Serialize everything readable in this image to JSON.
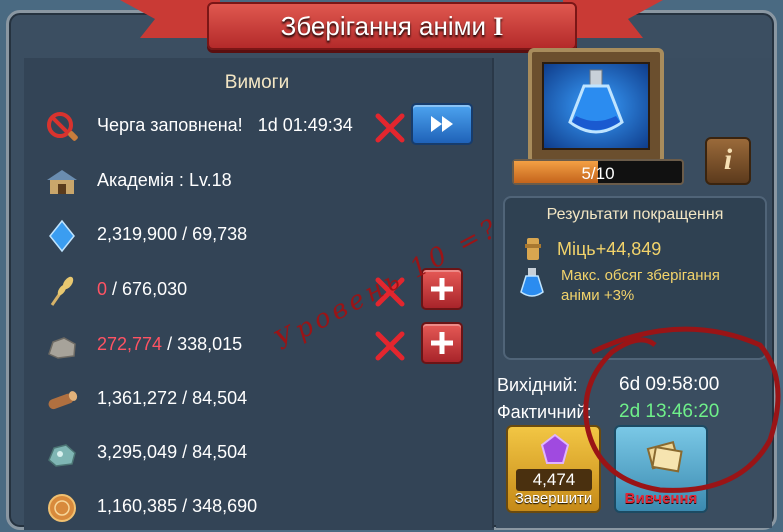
{
  "window": {
    "title": "Зберігання аніми",
    "title_roman": "I"
  },
  "requirements": {
    "header": "Вимоги",
    "rows": [
      {
        "icon": "queue-icon",
        "text": "Черга заповнена!",
        "extra": "1d 01:49:34",
        "status": "fail",
        "action": "speedup"
      },
      {
        "icon": "academy-icon",
        "label": "Академія :",
        "value": "Lv.18",
        "status": "ok"
      },
      {
        "icon": "anima-crystal-icon",
        "have": "2,319,900",
        "need": "69,738",
        "status": "ok"
      },
      {
        "icon": "grain-icon",
        "have": "0",
        "need": "676,030",
        "status": "fail",
        "action": "add"
      },
      {
        "icon": "stone-icon",
        "have": "272,774",
        "need": "338,015",
        "status": "fail",
        "action": "add"
      },
      {
        "icon": "timber-icon",
        "have": "1,361,272",
        "need": "84,504",
        "status": "ok"
      },
      {
        "icon": "ore-icon",
        "have": "3,295,049",
        "need": "84,504",
        "status": "ok"
      },
      {
        "icon": "gold-icon",
        "have": "1,160,385",
        "need": "348,690",
        "status": "ok"
      }
    ],
    "separator": " / "
  },
  "item": {
    "icon": "anima-potion-icon",
    "level_text": "5/10",
    "level_fraction": 0.5
  },
  "results": {
    "title": "Результати покращення",
    "power_label": "Міць",
    "power_value": "+44,849",
    "storage_text_1": "Макс. обсяг зберігання",
    "storage_text_2": "аніми +3%"
  },
  "times": {
    "original_label": "Вихідний:",
    "original_value": "6d 09:58:00",
    "actual_label": "Фактичний:",
    "actual_value": "2d 13:46:20"
  },
  "buttons": {
    "finish_cost": "4,474",
    "finish_label": "Завершити",
    "study_label": "Вивчення",
    "info_label": "i"
  },
  "annotation": {
    "handwritten": "Уровень 10 =?"
  },
  "colors": {
    "red_text": "#ff5363",
    "green_text": "#6ff08a",
    "gold_text": "#f2d36b",
    "annotation": "#9a1416"
  }
}
